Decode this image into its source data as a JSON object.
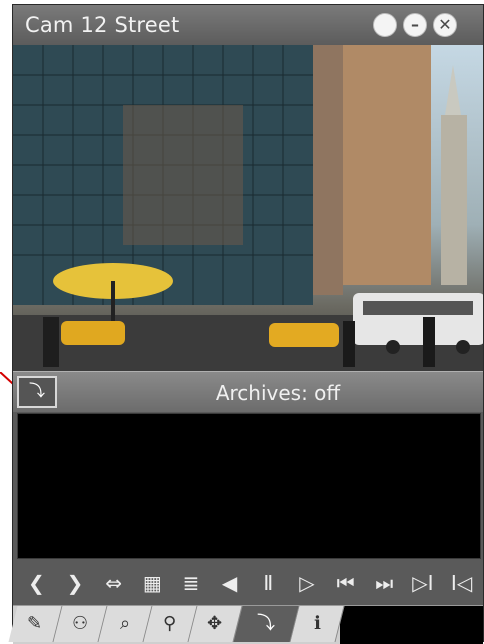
{
  "window": {
    "title": "Cam 12 Street"
  },
  "window_buttons": [
    "",
    "–",
    "✕"
  ],
  "archive": {
    "label": "Archives: off",
    "link_glyph": "⤵"
  },
  "controls": [
    "❮",
    "❯",
    "⇔",
    "▦",
    "≣",
    "◀",
    "Ⅱ",
    "▷",
    "⏮",
    "⏭",
    "▷I",
    "I◁"
  ],
  "tabs": [
    "✎",
    "⚇",
    "⌕",
    "⚲",
    "✥",
    "⤵",
    "ℹ"
  ],
  "colors": {
    "accent": "#5e5e5e",
    "annotation": "#d40000"
  }
}
